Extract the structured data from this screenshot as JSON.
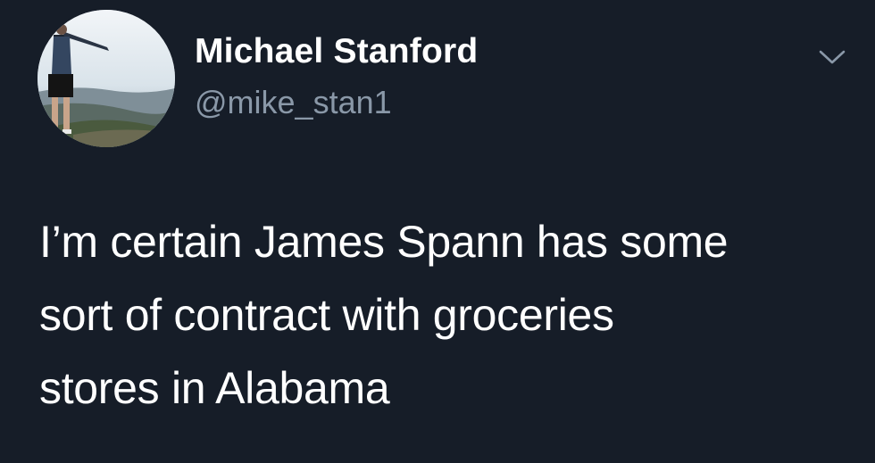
{
  "tweet": {
    "author": {
      "display_name": "Michael Stanford",
      "handle": "@mike_stan1"
    },
    "text_lines": [
      "I’m certain James Spann has some",
      "sort of contract with groceries",
      "stores in Alabama"
    ],
    "caret_icon": "chevron-down-icon"
  },
  "colors": {
    "background": "#161d28",
    "text": "#ffffff",
    "secondary_text": "#8a98a8"
  }
}
